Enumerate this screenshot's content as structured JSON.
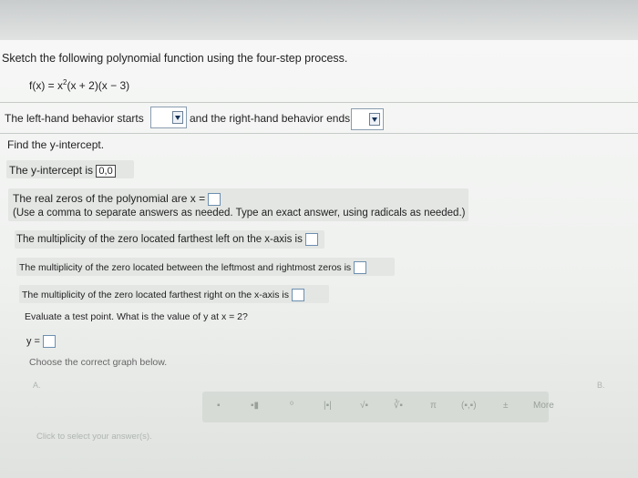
{
  "question": {
    "prompt": "Sketch the following polynomial function using the four-step process.",
    "function_label": "f(x) = x",
    "function_exp": "2",
    "function_rest": "(x + 2)(x − 3)"
  },
  "end_behavior": {
    "left_label": "The left-hand behavior starts",
    "right_label": "and the right-hand behavior ends",
    "left_value": "",
    "right_value": ""
  },
  "y_intercept": {
    "heading": "Find the y-intercept.",
    "label": "The y-intercept is",
    "value": "0,0"
  },
  "zeros": {
    "label": "The real zeros of the polynomial are x =",
    "hint": "(Use a comma to separate answers as needed. Type an exact answer, using radicals as needed.)"
  },
  "multiplicity": {
    "left": "The multiplicity of the zero located farthest left on the x-axis is",
    "middle": "The multiplicity of the zero located between the leftmost and rightmost zeros is",
    "right": "The multiplicity of the zero located farthest right on the x-axis is"
  },
  "test_point": {
    "label": "Evaluate a test point. What is the value of y at x = 2?",
    "y_label": "y ="
  },
  "graph": {
    "label": "Choose the correct graph below.",
    "option_a": "A.",
    "option_b": "B."
  },
  "toolbar": {
    "more": "More",
    "tools": [
      "▪",
      "▪▮",
      "⁰",
      "|▪|",
      "√▪",
      "∛▪",
      "π",
      "(▪,▪)",
      "±"
    ]
  },
  "footer": {
    "hint": "Click to select your answer(s)."
  }
}
